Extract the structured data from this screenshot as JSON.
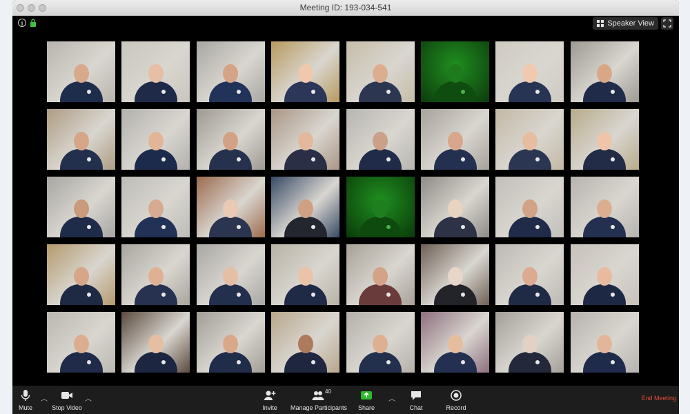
{
  "window": {
    "title": "Meeting ID: 193-034-541"
  },
  "topbar": {
    "speaker_view_label": "Speaker View",
    "speaker_icon": "grid-icon",
    "fullscreen_icon": "fullscreen-icon",
    "info_icon": "info-icon",
    "lock_icon": "lock-icon"
  },
  "gallery": {
    "rows": 5,
    "cols": 8,
    "tiles": [
      {
        "bg": "#b8b4ad",
        "skin": "#d8a98b",
        "suit": "#1f2d4d",
        "glow": false
      },
      {
        "bg": "#c9c6bf",
        "skin": "#e6bfa4",
        "suit": "#1e2a48",
        "glow": false
      },
      {
        "bg": "#a9a7a2",
        "skin": "#d5a385",
        "suit": "#22335a",
        "glow": false
      },
      {
        "bg": "#b79a5e",
        "skin": "#f0c8ae",
        "suit": "#2c3658",
        "glow": false
      },
      {
        "bg": "#c6bda8",
        "skin": "#dcae90",
        "suit": "#2d3650",
        "glow": false
      },
      {
        "bg": "#0d3a0d",
        "skin": "#1d7a1d",
        "suit": "#0f4c0f",
        "glow": true
      },
      {
        "bg": "#cfcbc3",
        "skin": "#f1c9ae",
        "suit": "#273453",
        "glow": false
      },
      {
        "bg": "#9d9a94",
        "skin": "#d9a786",
        "suit": "#1f2b48",
        "glow": false
      },
      {
        "bg": "#ad9c82",
        "skin": "#d7a688",
        "suit": "#23304d",
        "glow": false
      },
      {
        "bg": "#b3b1ad",
        "skin": "#e2b597",
        "suit": "#1c2a4b",
        "glow": false
      },
      {
        "bg": "#9e9a92",
        "skin": "#d3a184",
        "suit": "#26324d",
        "glow": false
      },
      {
        "bg": "#a99685",
        "skin": "#e4b89c",
        "suit": "#2a2f45",
        "glow": false
      },
      {
        "bg": "#b7b5b0",
        "skin": "#caa089",
        "suit": "#1f2b48",
        "glow": false
      },
      {
        "bg": "#a7a29a",
        "skin": "#d8a68a",
        "suit": "#24304f",
        "glow": false
      },
      {
        "bg": "#c3b8a4",
        "skin": "#e6bda1",
        "suit": "#2b3653",
        "glow": false
      },
      {
        "bg": "#b8ab8b",
        "skin": "#f0c4a8",
        "suit": "#222c47",
        "glow": false
      },
      {
        "bg": "#a8a6a2",
        "skin": "#c99b7c",
        "suit": "#1f2c49",
        "glow": false
      },
      {
        "bg": "#bebcb8",
        "skin": "#d7ab91",
        "suit": "#223256",
        "glow": false
      },
      {
        "bg": "#9d6b4e",
        "skin": "#eac9b5",
        "suit": "#2c3550",
        "glow": false
      },
      {
        "bg": "#384a66",
        "skin": "#cfa084",
        "suit": "#23262e",
        "glow": false
      },
      {
        "bg": "#0a3a0a",
        "skin": "#1f7f1f",
        "suit": "#0e4a0e",
        "glow": true
      },
      {
        "bg": "#8e8b86",
        "skin": "#e9d3c1",
        "suit": "#2d3246",
        "glow": false
      },
      {
        "bg": "#c2bfba",
        "skin": "#d1a287",
        "suit": "#1f2b48",
        "glow": false
      },
      {
        "bg": "#b7b4af",
        "skin": "#dcae91",
        "suit": "#23304f",
        "glow": false
      },
      {
        "bg": "#b49a6c",
        "skin": "#d7a688",
        "suit": "#1e2a44",
        "glow": false
      },
      {
        "bg": "#a9a69f",
        "skin": "#dfb193",
        "suit": "#26324f",
        "glow": false
      },
      {
        "bg": "#a9a7a4",
        "skin": "#e5bfa3",
        "suit": "#22304e",
        "glow": false
      },
      {
        "bg": "#b8b3a6",
        "skin": "#eac3a8",
        "suit": "#1f2a46",
        "glow": false
      },
      {
        "bg": "#a7a197",
        "skin": "#d3a386",
        "suit": "#6a3b3b",
        "glow": false
      },
      {
        "bg": "#6e5f55",
        "skin": "#e8d6c8",
        "suit": "#23242a",
        "glow": false
      },
      {
        "bg": "#bdbab5",
        "skin": "#dcaa90",
        "suit": "#1f2a45",
        "glow": false
      },
      {
        "bg": "#c7c2ba",
        "skin": "#e8bba0",
        "suit": "#1d2944",
        "glow": false
      },
      {
        "bg": "#bab7b1",
        "skin": "#dcad90",
        "suit": "#1f2b48",
        "glow": false
      },
      {
        "bg": "#5a4a3e",
        "skin": "#e6bea2",
        "suit": "#1c2640",
        "glow": false
      },
      {
        "bg": "#a19d96",
        "skin": "#d8a889",
        "suit": "#1f2c4a",
        "glow": false
      },
      {
        "bg": "#b9a78c",
        "skin": "#ad7a5e",
        "suit": "#1f2740",
        "glow": false
      },
      {
        "bg": "#b4b0a9",
        "skin": "#ddb092",
        "suit": "#22304d",
        "glow": false
      },
      {
        "bg": "#8d6f7e",
        "skin": "#e6be9e",
        "suit": "#233051",
        "glow": false
      },
      {
        "bg": "#a39f98",
        "skin": "#e1d2c4",
        "suit": "#23283a",
        "glow": false
      },
      {
        "bg": "#b6b3ae",
        "skin": "#e3b69c",
        "suit": "#1f2b4a",
        "glow": false
      }
    ]
  },
  "toolbar": {
    "mute_label": "Mute",
    "stop_video_label": "Stop Video",
    "invite_label": "Invite",
    "manage_participants_label": "Manage Participants",
    "participant_count": "40",
    "share_label": "Share",
    "chat_label": "Chat",
    "record_label": "Record",
    "end_meeting_label": "End Meeting",
    "share_color": "#2eb82e",
    "end_color": "#e24b3a"
  }
}
